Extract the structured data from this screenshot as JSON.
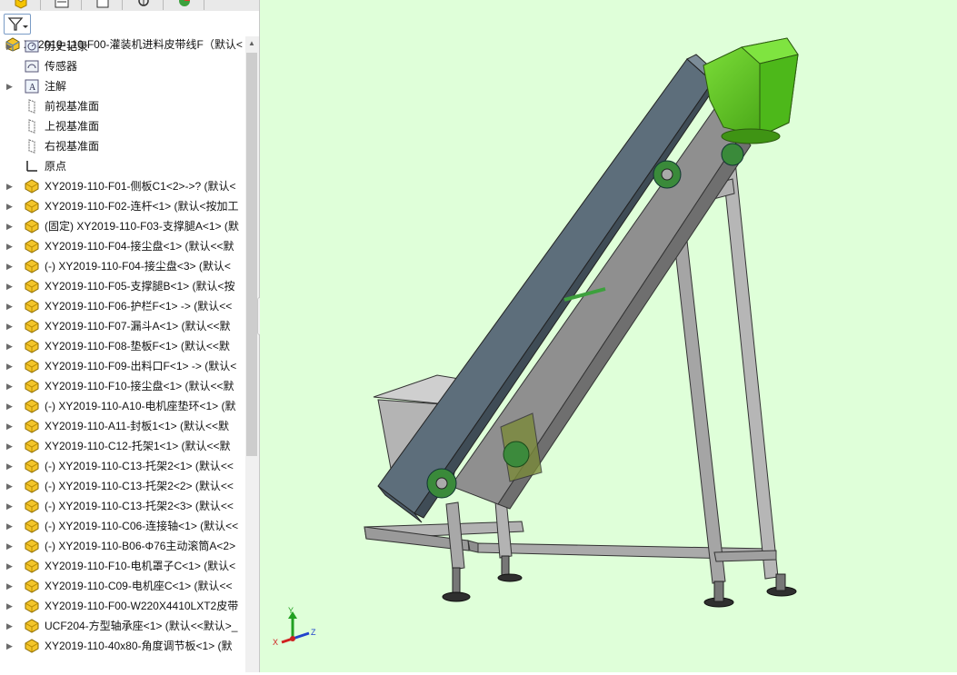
{
  "root": {
    "label": "XY2019-110-F00-灌装机进料皮带线F（默认<"
  },
  "tree": {
    "items": [
      {
        "label": "历史记录",
        "icon": "history-icon",
        "expandable": true
      },
      {
        "label": "传感器",
        "icon": "sensor-icon",
        "expandable": false
      },
      {
        "label": "注解",
        "icon": "annotation-icon",
        "expandable": true
      },
      {
        "label": "前视基准面",
        "icon": "plane-icon",
        "expandable": false
      },
      {
        "label": "上视基准面",
        "icon": "plane-icon",
        "expandable": false
      },
      {
        "label": "右视基准面",
        "icon": "plane-icon",
        "expandable": false
      },
      {
        "label": "原点",
        "icon": "origin-icon",
        "expandable": false
      },
      {
        "label": "XY2019-110-F01-侧板C1<2>->? (默认<",
        "icon": "part-icon",
        "expandable": true
      },
      {
        "label": "XY2019-110-F02-连杆<1> (默认<按加工",
        "icon": "part-icon",
        "expandable": true
      },
      {
        "label": "(固定) XY2019-110-F03-支撑腿A<1> (默",
        "icon": "part-icon",
        "expandable": true
      },
      {
        "label": "XY2019-110-F04-接尘盘<1> (默认<<默",
        "icon": "part-icon",
        "expandable": true
      },
      {
        "label": "(-) XY2019-110-F04-接尘盘<3> (默认<",
        "icon": "part-icon",
        "expandable": true
      },
      {
        "label": "XY2019-110-F05-支撑腿B<1> (默认<按",
        "icon": "part-icon",
        "expandable": true
      },
      {
        "label": "XY2019-110-F06-护栏F<1> -> (默认<<",
        "icon": "part-icon",
        "expandable": true
      },
      {
        "label": "XY2019-110-F07-漏斗A<1> (默认<<默",
        "icon": "part-icon",
        "expandable": true
      },
      {
        "label": "XY2019-110-F08-垫板F<1> (默认<<默",
        "icon": "part-icon",
        "expandable": true
      },
      {
        "label": "XY2019-110-F09-出料口F<1> -> (默认<",
        "icon": "part-icon",
        "expandable": true
      },
      {
        "label": "XY2019-110-F10-接尘盘<1> (默认<<默",
        "icon": "part-icon",
        "expandable": true
      },
      {
        "label": "(-) XY2019-110-A10-电机座垫环<1> (默",
        "icon": "part-icon",
        "expandable": true
      },
      {
        "label": "XY2019-110-A11-封板1<1> (默认<<默",
        "icon": "part-icon",
        "expandable": true
      },
      {
        "label": "XY2019-110-C12-托架1<1> (默认<<默",
        "icon": "part-icon",
        "expandable": true
      },
      {
        "label": "(-) XY2019-110-C13-托架2<1> (默认<<",
        "icon": "part-icon",
        "expandable": true
      },
      {
        "label": "(-) XY2019-110-C13-托架2<2> (默认<<",
        "icon": "part-icon",
        "expandable": true
      },
      {
        "label": "(-) XY2019-110-C13-托架2<3> (默认<<",
        "icon": "part-icon",
        "expandable": true
      },
      {
        "label": "(-) XY2019-110-C06-连接轴<1> (默认<<",
        "icon": "part-icon",
        "expandable": true
      },
      {
        "label": "(-) XY2019-110-B06-Φ76主动滚筒A<2>",
        "icon": "part-icon",
        "expandable": true
      },
      {
        "label": "XY2019-110-F10-电机罩子C<1> (默认<",
        "icon": "part-icon",
        "expandable": true
      },
      {
        "label": "XY2019-110-C09-电机座C<1> (默认<<",
        "icon": "part-icon",
        "expandable": true
      },
      {
        "label": "XY2019-110-F00-W220X4410LXT2皮带",
        "icon": "part-icon",
        "expandable": true
      },
      {
        "label": "UCF204-方型轴承座<1> (默认<<默认>_",
        "icon": "part-icon",
        "expandable": true
      },
      {
        "label": "XY2019-110-40x80-角度调节板<1> (默",
        "icon": "part-icon",
        "expandable": true
      }
    ]
  },
  "triad": {
    "x": "X",
    "y": "Y",
    "z": "Z"
  },
  "colors": {
    "background": "#dfffd9",
    "motor": "#58c218",
    "frame": "#a8a8a8",
    "belt": "#5d6e7b"
  }
}
